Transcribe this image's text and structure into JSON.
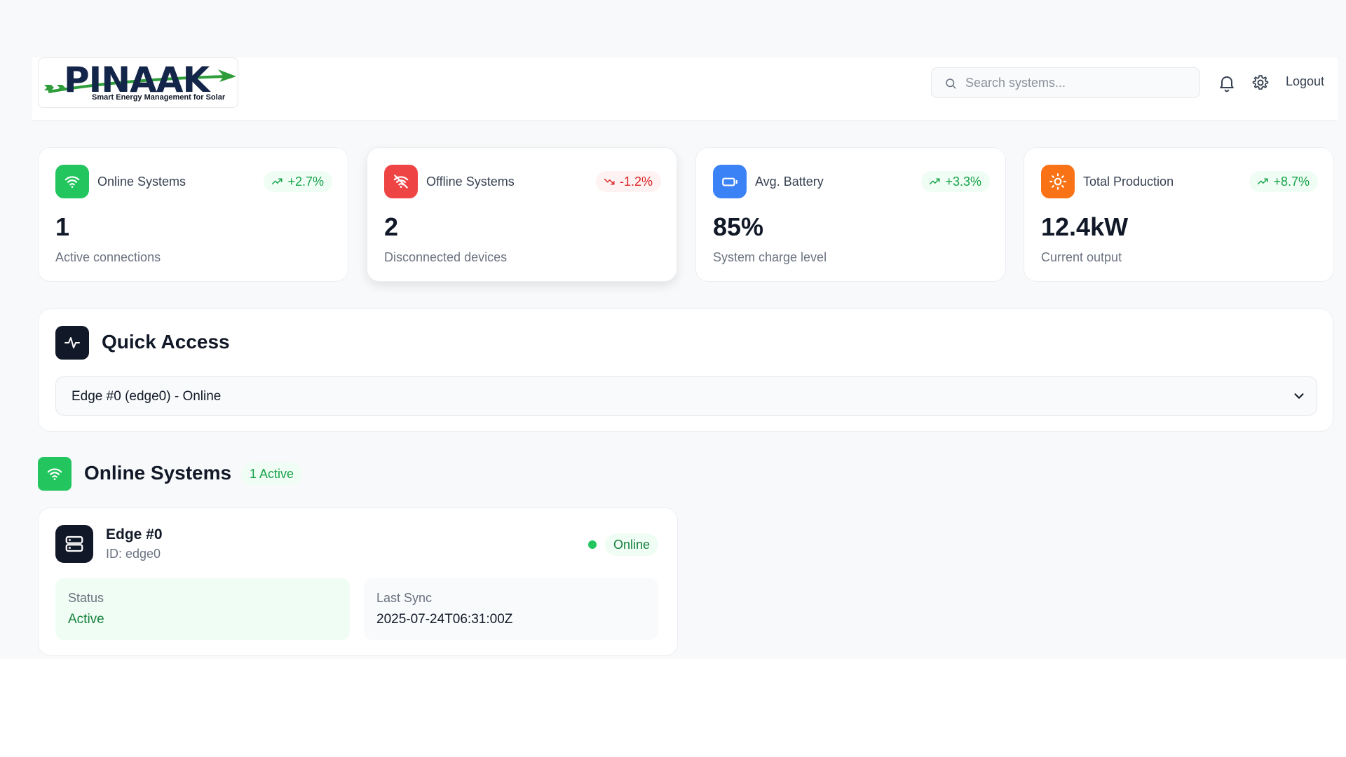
{
  "brand": {
    "name": "PINAAK",
    "tagline": "Smart Energy Management for Solar"
  },
  "header": {
    "search_placeholder": "Search systems...",
    "logout_label": "Logout"
  },
  "stats": [
    {
      "label": "Online Systems",
      "trend": "+2.7%",
      "trend_direction": "up",
      "value": "1",
      "subtitle": "Active connections",
      "icon": "wifi-icon",
      "color": "#22c55e"
    },
    {
      "label": "Offline Systems",
      "trend": "-1.2%",
      "trend_direction": "down",
      "value": "2",
      "subtitle": "Disconnected devices",
      "icon": "wifi-off-icon",
      "color": "#ef4444"
    },
    {
      "label": "Avg. Battery",
      "trend": "+3.3%",
      "trend_direction": "up",
      "value": "85%",
      "subtitle": "System charge level",
      "icon": "battery-icon",
      "color": "#3b82f6"
    },
    {
      "label": "Total Production",
      "trend": "+8.7%",
      "trend_direction": "up",
      "value": "12.4kW",
      "subtitle": "Current output",
      "icon": "sun-icon",
      "color": "#f97316"
    }
  ],
  "quick_access": {
    "title": "Quick Access",
    "selected": "Edge #0 (edge0) - Online"
  },
  "online_section": {
    "title": "Online Systems",
    "badge": "1 Active",
    "systems": [
      {
        "name": "Edge #0",
        "id_text": "ID: edge0",
        "status_badge": "Online",
        "status_label": "Status",
        "status_value": "Active",
        "sync_label": "Last Sync",
        "sync_value": "2025-07-24T06:31:00Z"
      }
    ]
  }
}
